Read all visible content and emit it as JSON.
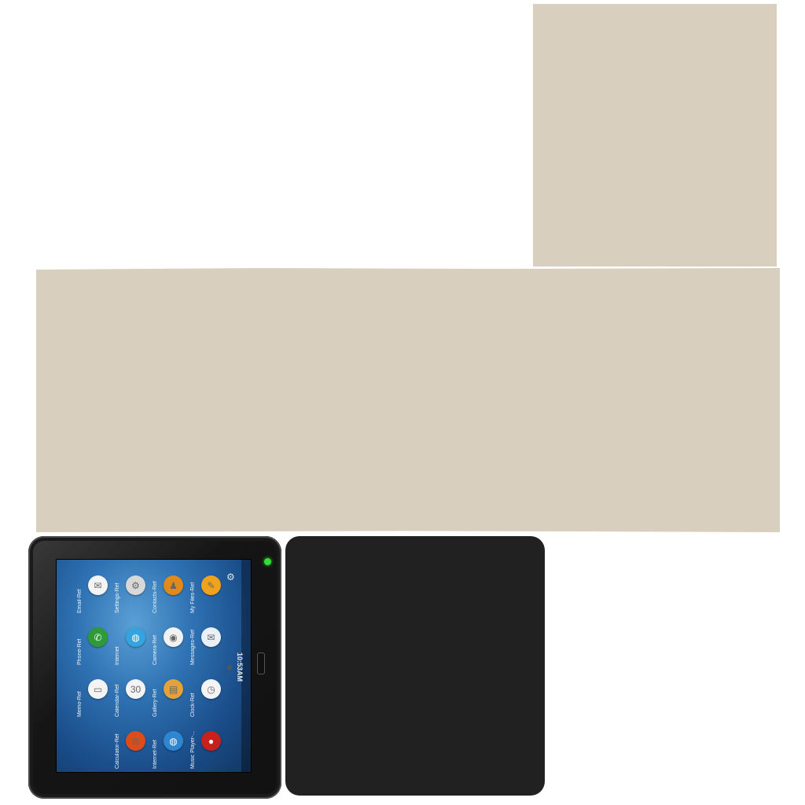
{
  "tablet": {
    "clock": "10:53AM",
    "settings_icon": "gear-icon",
    "apps": [
      {
        "label": "My Files-Ref",
        "icon": "folder-icon",
        "color": "#f1a21c",
        "glyph": "✎"
      },
      {
        "label": "Messages-Ref",
        "icon": "messages-icon",
        "color": "#e9f0f6",
        "glyph": "✉"
      },
      {
        "label": "Clock-Ref",
        "icon": "clock-icon",
        "color": "#f4f4f4",
        "glyph": "◷"
      },
      {
        "label": "Music Player-...",
        "icon": "music-player-icon",
        "color": "#c8211c",
        "glyph": "●"
      },
      {
        "label": "Contacts-Ref",
        "icon": "contacts-icon",
        "color": "#e08a1c",
        "glyph": "♟"
      },
      {
        "label": "Camera-Ref",
        "icon": "camera-icon",
        "color": "#f2f2f2",
        "glyph": "◉"
      },
      {
        "label": "Gallery-Ref",
        "icon": "gallery-icon",
        "color": "#e3a23a",
        "glyph": "▤"
      },
      {
        "label": "Internet-Ref",
        "icon": "internet-icon",
        "color": "#2f86d0",
        "glyph": "◍"
      },
      {
        "label": "Settings-Ref",
        "icon": "settings-icon",
        "color": "#d8d8d8",
        "glyph": "⚙"
      },
      {
        "label": "Internet",
        "icon": "globe-icon",
        "color": "#35a3de",
        "glyph": "◍"
      },
      {
        "label": "Calendar-Ref",
        "icon": "calendar-icon",
        "color": "#f4f4f4",
        "glyph": "30"
      },
      {
        "label": "Calculator-Ref",
        "icon": "calculator-icon",
        "color": "#e04b1a",
        "glyph": "⊞"
      },
      {
        "label": "Email-Ref",
        "icon": "email-icon",
        "color": "#f4f4f4",
        "glyph": "✉"
      },
      {
        "label": "Phone-Ref",
        "icon": "phone-icon",
        "color": "#2f9a3a",
        "glyph": "✆"
      },
      {
        "label": "Memo-Ref",
        "icon": "memo-icon",
        "color": "#f4f4f4",
        "glyph": "▭"
      }
    ]
  },
  "colors": {
    "backdrop_panel": "#d9cfbf",
    "device_body": "#1a1a1a",
    "back_cover": "#212121",
    "led": "#33dd33"
  }
}
